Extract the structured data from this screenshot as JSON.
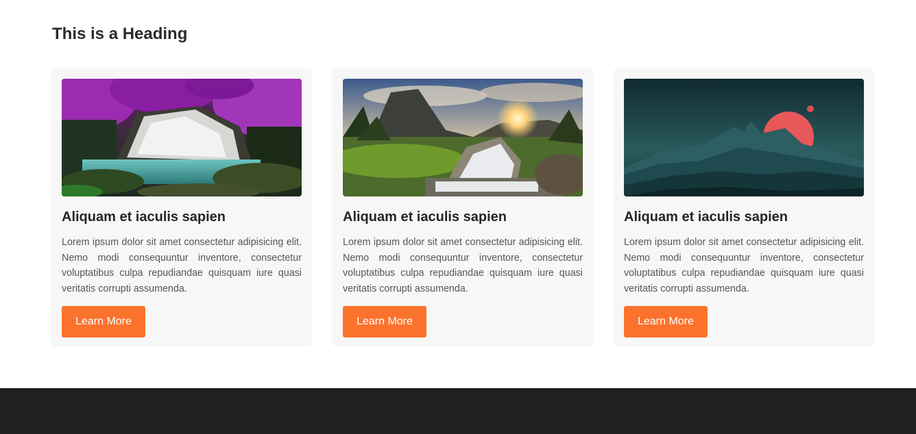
{
  "section": {
    "heading": "This is a Heading"
  },
  "cards": [
    {
      "image": "waterfall-forest-purple-image",
      "title": "Aliquam et iaculis sapien",
      "text": "Lorem ipsum dolor sit amet consectetur adipisicing elit. Nemo modi consequuntur inventore, consectetur voluptatibus culpa repudiandae quisquam iure quasi veritatis corrupti assumenda.",
      "button_label": "Learn More"
    },
    {
      "image": "mountain-sunset-waterfall-image",
      "title": "Aliquam et iaculis sapien",
      "text": "Lorem ipsum dolor sit amet consectetur adipisicing elit. Nemo modi consequuntur inventore, consectetur voluptatibus culpa repudiandae quisquam iure quasi veritatis corrupti assumenda.",
      "button_label": "Learn More"
    },
    {
      "image": "teal-mountains-red-moon-image",
      "title": "Aliquam et iaculis sapien",
      "text": "Lorem ipsum dolor sit amet consectetur adipisicing elit. Nemo modi consequuntur inventore, consectetur voluptatibus culpa repudiandae quisquam iure quasi veritatis corrupti assumenda.",
      "button_label": "Learn More"
    }
  ],
  "colors": {
    "accent": "#fb722d",
    "card_background": "#f7f7f7",
    "footer_background": "#202020"
  }
}
